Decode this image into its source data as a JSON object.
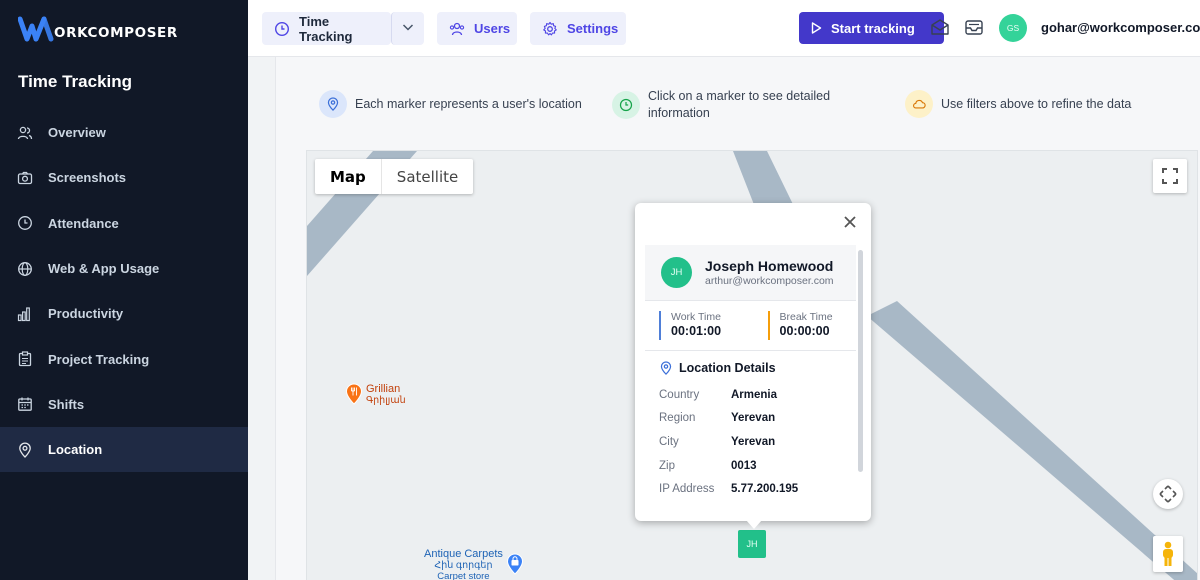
{
  "brand": {
    "logo_text": "ORKCOMPOSER"
  },
  "sidebar": {
    "section_title": "Time Tracking",
    "items": [
      {
        "label": "Overview",
        "icon": "users-icon"
      },
      {
        "label": "Screenshots",
        "icon": "camera-icon"
      },
      {
        "label": "Attendance",
        "icon": "clock-icon"
      },
      {
        "label": "Web & App Usage",
        "icon": "globe-icon"
      },
      {
        "label": "Productivity",
        "icon": "bar-chart-icon"
      },
      {
        "label": "Project Tracking",
        "icon": "clipboard-icon"
      },
      {
        "label": "Shifts",
        "icon": "calendar-icon"
      },
      {
        "label": "Location",
        "icon": "map-pin-icon",
        "active": true
      }
    ]
  },
  "topbar": {
    "time_tracking_label": "Time Tracking",
    "users_label": "Users",
    "settings_label": "Settings",
    "start_tracking_label": "Start tracking",
    "user_initials": "GS",
    "user_email": "gohar@workcomposer.com"
  },
  "hints": [
    {
      "text": "Each marker represents a user's location",
      "icon": "map-pin-icon"
    },
    {
      "text_line1": "Click on a marker to see detailed",
      "text_line2": "information",
      "icon": "clock-icon"
    },
    {
      "text": "Use filters above to refine the data",
      "icon": "cloud-icon"
    }
  ],
  "map": {
    "map_type_map": "Map",
    "map_type_satellite": "Satellite",
    "poi": [
      {
        "name": "Grillian",
        "sub": "Գրիլյան",
        "icon": "restaurant-icon"
      },
      {
        "name": "Antique Carpets",
        "sub1": "Հին գորգեր",
        "sub2": "Carpet store",
        "icon": "shopping-bag-icon"
      }
    ],
    "marker_initials": "JH"
  },
  "popup": {
    "initials": "JH",
    "name": "Joseph Homewood",
    "email": "arthur@workcomposer.com",
    "work_time_label": "Work Time",
    "work_time": "00:01:00",
    "break_time_label": "Break Time",
    "break_time": "00:00:00",
    "location_title": "Location Details",
    "details": [
      {
        "key": "Country",
        "value": "Armenia"
      },
      {
        "key": "Region",
        "value": "Yerevan"
      },
      {
        "key": "City",
        "value": "Yerevan"
      },
      {
        "key": "Zip",
        "value": "0013"
      },
      {
        "key": "IP Address",
        "value": "5.77.200.195"
      }
    ]
  },
  "colors": {
    "sidebar_bg": "#111827",
    "accent": "#4338ca",
    "marker": "#22c08a",
    "road": "#a8b8c6"
  }
}
